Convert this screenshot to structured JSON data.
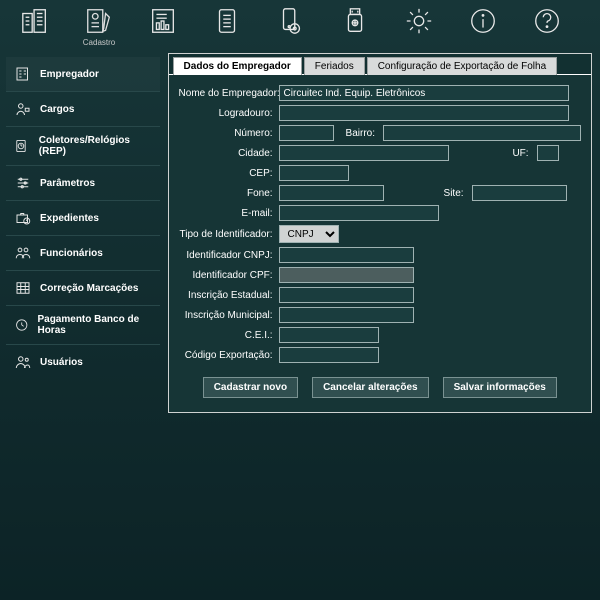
{
  "topbar": {
    "items": [
      {
        "name": "company",
        "label": ""
      },
      {
        "name": "cadastro",
        "label": "Cadastro"
      },
      {
        "name": "reports",
        "label": ""
      },
      {
        "name": "lists",
        "label": ""
      },
      {
        "name": "mobile",
        "label": ""
      },
      {
        "name": "usb",
        "label": ""
      },
      {
        "name": "settings",
        "label": ""
      },
      {
        "name": "info",
        "label": ""
      },
      {
        "name": "help",
        "label": ""
      }
    ]
  },
  "sidebar": {
    "items": [
      "Empregador",
      "Cargos",
      "Coletores/Relógios (REP)",
      "Parâmetros",
      "Expedientes",
      "Funcionários",
      "Correção Marcações",
      "Pagamento Banco de Horas",
      "Usuários"
    ]
  },
  "tabs": {
    "items": [
      "Dados do Empregador",
      "Feriados",
      "Configuração de Exportação de Folha"
    ],
    "active": 0
  },
  "form": {
    "labels": {
      "nome": "Nome do Empregador:",
      "logradouro": "Logradouro:",
      "numero": "Número:",
      "bairro": "Bairro:",
      "cidade": "Cidade:",
      "uf": "UF:",
      "cep": "CEP:",
      "fone": "Fone:",
      "site": "Site:",
      "email": "E-mail:",
      "tipo_id": "Tipo de Identificador:",
      "cnpj": "Identificador CNPJ:",
      "cpf": "Identificador CPF:",
      "insc_est": "Inscrição Estadual:",
      "insc_mun": "Inscrição Municipal:",
      "cei": "C.E.I.:",
      "cod_exp": "Código Exportação:"
    },
    "values": {
      "nome": "Circuitec Ind. Equip. Eletrônicos",
      "logradouro": "",
      "numero": "",
      "bairro": "",
      "cidade": "",
      "uf": "",
      "cep": "",
      "fone": "",
      "site": "",
      "email": "",
      "tipo_id": "CNPJ",
      "cnpj": "",
      "cpf": "",
      "insc_est": "",
      "insc_mun": "",
      "cei": "",
      "cod_exp": ""
    }
  },
  "actions": {
    "new": "Cadastrar novo",
    "cancel": "Cancelar alterações",
    "save": "Salvar informações"
  }
}
